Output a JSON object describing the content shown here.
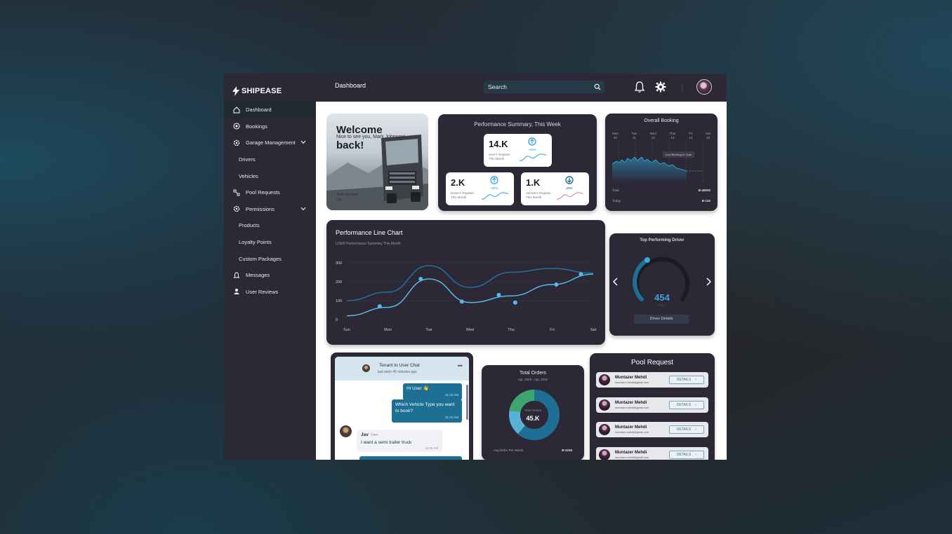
{
  "brand": {
    "name": "SHIPEASE"
  },
  "sidebar": {
    "items": [
      {
        "label": "Dashboard",
        "icon": "home-icon",
        "active": true
      },
      {
        "label": "Bookings",
        "icon": "bookings-icon"
      },
      {
        "label": "Garage Management",
        "icon": "garage-icon",
        "expandable": true
      },
      {
        "label": "Drivers",
        "sub": true
      },
      {
        "label": "Vehicles",
        "sub": true
      },
      {
        "label": "Pool Requests",
        "icon": "pool-icon"
      },
      {
        "label": "Permissions",
        "icon": "permissions-icon",
        "expandable": true
      },
      {
        "label": "Products",
        "sub": true
      },
      {
        "label": "Loyalty Points",
        "sub": true
      },
      {
        "label": "Custom Packages",
        "sub": true
      },
      {
        "label": "Messages",
        "icon": "bell-icon"
      },
      {
        "label": "User Reviews",
        "icon": "user-icon"
      }
    ]
  },
  "header": {
    "title": "Dashboard",
    "search_placeholder": "Search"
  },
  "welcome": {
    "line1": "Welcome",
    "line2": "Nice to see you, Mark Johnson!",
    "line3": "back!",
    "caption": "Turn on your car"
  },
  "performance_summary": {
    "title": "Performance Summary, This Week",
    "stats": [
      {
        "value": "14.K",
        "label": "User's Register This Month",
        "trend": "+20%",
        "direction": "up"
      },
      {
        "value": "2.K",
        "label": "Driver's Register This Month",
        "trend": "+20%",
        "direction": "up"
      },
      {
        "value": "1.K",
        "label": "Vehicle's Register This Month",
        "trend": "-20%",
        "direction": "down"
      }
    ]
  },
  "overall_booking": {
    "title": "Overall Booking",
    "days": [
      {
        "name": "Mon",
        "num": "10"
      },
      {
        "name": "Tue",
        "num": "11"
      },
      {
        "name": "Wed",
        "num": "12"
      },
      {
        "name": "Thur",
        "num": "13"
      },
      {
        "name": "Fri",
        "num": "14"
      },
      {
        "name": "Sat",
        "num": "15"
      }
    ],
    "tooltip": "Low Booking In June",
    "total_label": "Total",
    "total_value": "B-45000",
    "today_label": "Today",
    "today_value": "B-132"
  },
  "line_chart": {
    "title": "Performance Line Chart",
    "subtitle": "USER Performance Summary This Month"
  },
  "chart_data": {
    "type": "line",
    "categories": [
      "Sun",
      "Mon",
      "Tue",
      "Wed",
      "Thu",
      "Fri",
      "Sat"
    ],
    "y_ticks": [
      "300",
      "200",
      "100",
      "0"
    ],
    "ylim": [
      0,
      300
    ],
    "series": [
      {
        "values": [
          100,
          145,
          285,
          170,
          250,
          270,
          245
        ],
        "color": "#1e6f9a"
      },
      {
        "values": [
          20,
          65,
          215,
          90,
          125,
          185,
          240
        ],
        "color": "#58b8e8"
      }
    ],
    "points_series2": [
      {
        "x": 0.8,
        "y": 70
      },
      {
        "x": 1.8,
        "y": 215
      },
      {
        "x": 2.8,
        "y": 95
      },
      {
        "x": 3.7,
        "y": 130
      },
      {
        "x": 4.1,
        "y": 90
      },
      {
        "x": 5.1,
        "y": 185
      },
      {
        "x": 5.7,
        "y": 240
      }
    ],
    "grid": true
  },
  "top_driver": {
    "title": "Top Performing Driver",
    "value": "454",
    "sub": "Rides",
    "button": "Driver Details",
    "progress": 0.35
  },
  "chat": {
    "title": "Tenant to User Chat",
    "last_seen": "last seen 45 minutes ago",
    "messages": [
      {
        "text": "Hi User 👋",
        "time": "11:31 AM"
      },
      {
        "text": "Which Vehicle Type you want to book?",
        "time": "11:31 AM"
      }
    ],
    "incoming": {
      "name": "Jav",
      "role": "User",
      "text": "I want a semi trailer truck",
      "time": "11:35 AM"
    }
  },
  "total_orders": {
    "title": "Total Orders",
    "date_range": "Apr, 2022 - Apr, 2022",
    "center_label": "Total Orders",
    "center_value": "45.K",
    "footer_label": "Avg.Order Per Month",
    "footer_value": "B-3246"
  },
  "pool_request": {
    "title": "Pool Request",
    "items": [
      {
        "name": "Muntazer Mehdi",
        "email": "muntazer.mehdi@gmail.com",
        "button": "DETAILS"
      },
      {
        "name": "Muntazer Mehdi",
        "email": "muntazer.mehdi@gmail.com",
        "button": "DETAILS"
      },
      {
        "name": "Muntazer Mehdi",
        "email": "muntazer.mehdi@gmail.com",
        "button": "DETAILS"
      },
      {
        "name": "Muntazer Mehdi",
        "email": "muntazer.mehdi@gmail.com",
        "button": "DETAILS"
      }
    ]
  },
  "colors": {
    "panel": "#2c2836",
    "accent": "#2a9bd8",
    "header": "#2c2836"
  }
}
